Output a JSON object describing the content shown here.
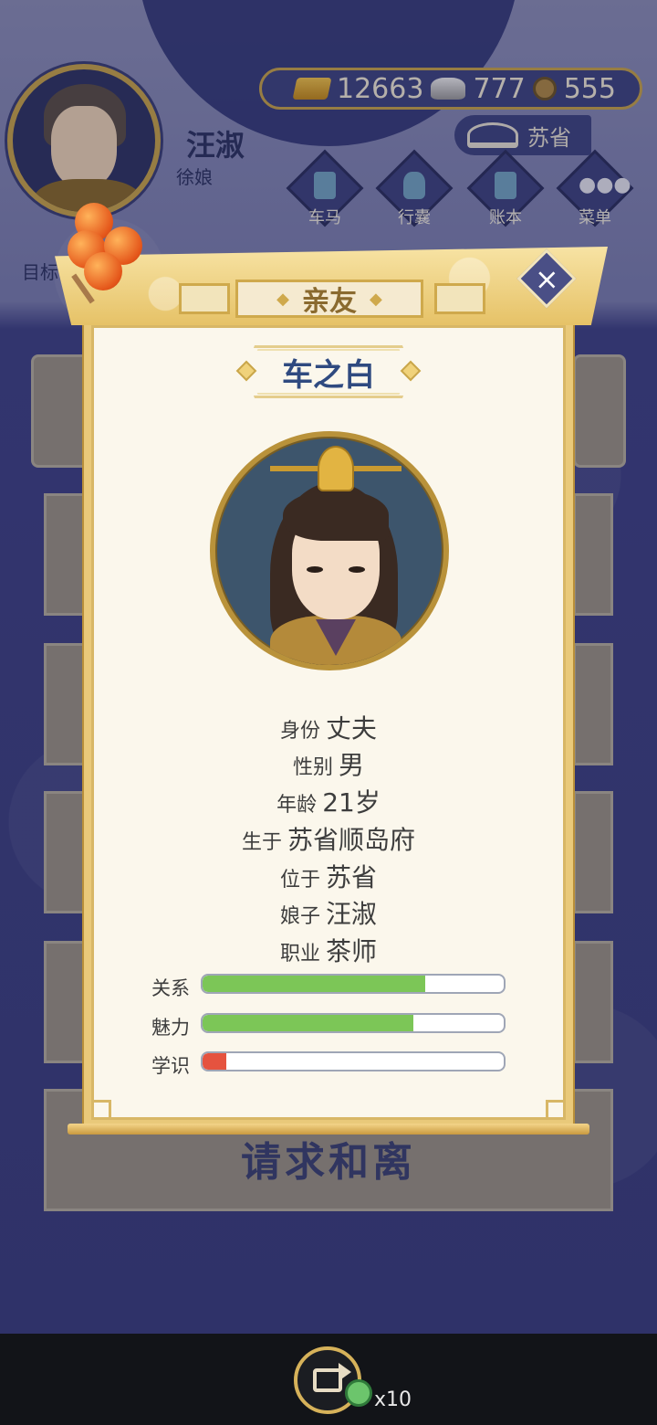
{
  "header": {
    "player_name": "汪淑",
    "player_title": "徐娘",
    "currency": {
      "gold": "12663",
      "silver": "777",
      "coins": "555"
    },
    "location": "苏省",
    "nav": [
      {
        "label": "车马"
      },
      {
        "label": "行囊"
      },
      {
        "label": "账本"
      },
      {
        "label": "菜单"
      }
    ],
    "goal_label": "目标"
  },
  "background": {
    "divorce_button_label": "请求和离"
  },
  "modal": {
    "tab_title": "亲友",
    "close_icon": "close-icon",
    "character_name": "车之白",
    "info": [
      {
        "key": "身份",
        "value": "丈夫"
      },
      {
        "key": "性别",
        "value": "男"
      },
      {
        "key": "年龄",
        "value": "21岁"
      },
      {
        "key": "生于",
        "value": "苏省顺岛府"
      },
      {
        "key": "位于",
        "value": "苏省"
      },
      {
        "key": "娘子",
        "value": "汪淑"
      },
      {
        "key": "职业",
        "value": "茶师"
      }
    ],
    "stats": [
      {
        "label": "关系",
        "fraction": 0.74,
        "color": "#7cc657"
      },
      {
        "label": "魅力",
        "fraction": 0.7,
        "color": "#7cc657"
      },
      {
        "label": "学识",
        "fraction": 0.08,
        "color": "#e5533f"
      }
    ]
  },
  "footer": {
    "share_icon": "share-icon",
    "reward_count": "x10"
  }
}
